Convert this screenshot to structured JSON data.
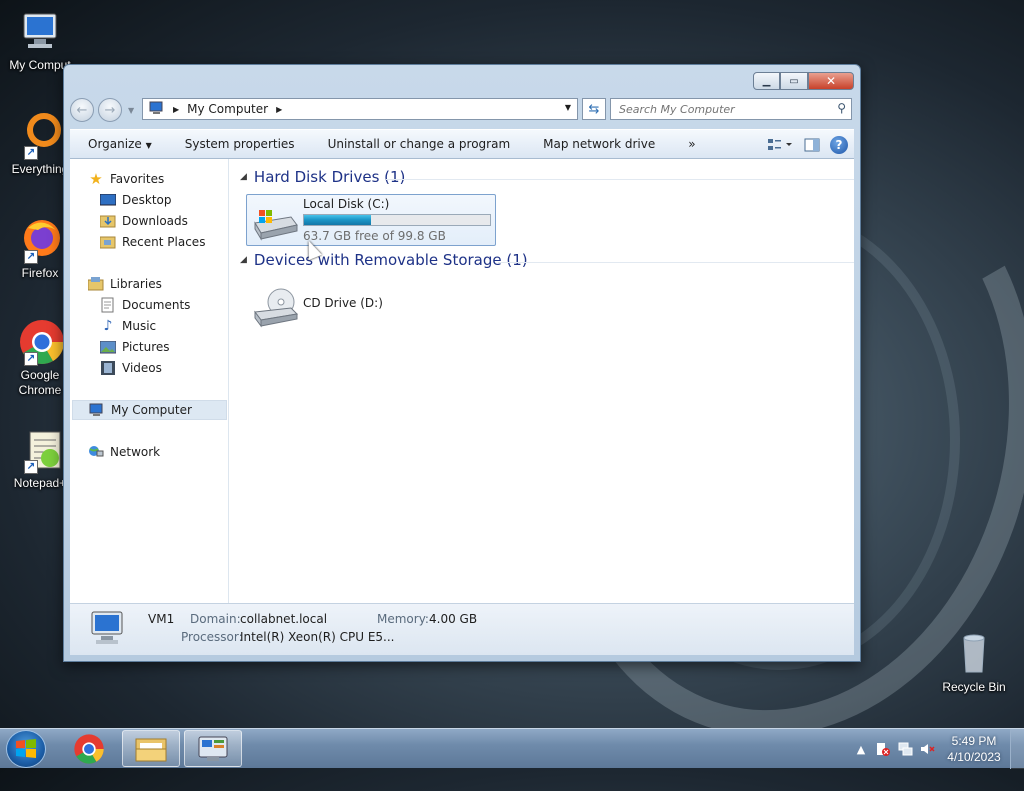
{
  "desktop": {
    "icons": [
      {
        "label": "My Comput",
        "icon": "computer-icon"
      },
      {
        "label": "Everything",
        "icon": "everything-icon"
      },
      {
        "label": "Firefox",
        "icon": "firefox-icon"
      },
      {
        "label": "Google\nChrome",
        "icon": "chrome-icon"
      },
      {
        "label": "Notepad+",
        "icon": "notepad-plus-icon"
      },
      {
        "label": "Recycle Bin",
        "icon": "recycle-bin-icon"
      }
    ]
  },
  "window": {
    "address": {
      "location": "My Computer"
    },
    "search": {
      "placeholder": "Search My Computer"
    },
    "toolbar": {
      "organize": "Organize",
      "system_properties": "System properties",
      "uninstall": "Uninstall or change a program",
      "map_drive": "Map network drive",
      "more": "»"
    },
    "nav": {
      "favorites": "Favorites",
      "desktop": "Desktop",
      "downloads": "Downloads",
      "recent": "Recent Places",
      "libraries": "Libraries",
      "documents": "Documents",
      "music": "Music",
      "pictures": "Pictures",
      "videos": "Videos",
      "my_computer": "My Computer",
      "network": "Network"
    },
    "groups": {
      "hard_disks": "Hard Disk Drives (1)",
      "removable": "Devices with Removable Storage (1)"
    },
    "drives": {
      "c": {
        "name": "Local Disk (C:)",
        "free_text": "63.7 GB free of 99.8 GB",
        "used_fraction": 0.362
      },
      "d": {
        "name": "CD Drive (D:)"
      }
    },
    "details": {
      "computer_name": "VM1",
      "domain_label": "Domain:",
      "domain_value": "collabnet.local",
      "memory_label": "Memory:",
      "memory_value": "4.00 GB",
      "processor_label": "Processor:",
      "processor_value": "Intel(R) Xeon(R) CPU E5..."
    }
  },
  "taskbar": {
    "time": "5:49 PM",
    "date": "4/10/2023"
  },
  "colors": {
    "accent": "#1e3287",
    "drive_bar": "#1d98c9",
    "selection": "#dde8f3"
  }
}
